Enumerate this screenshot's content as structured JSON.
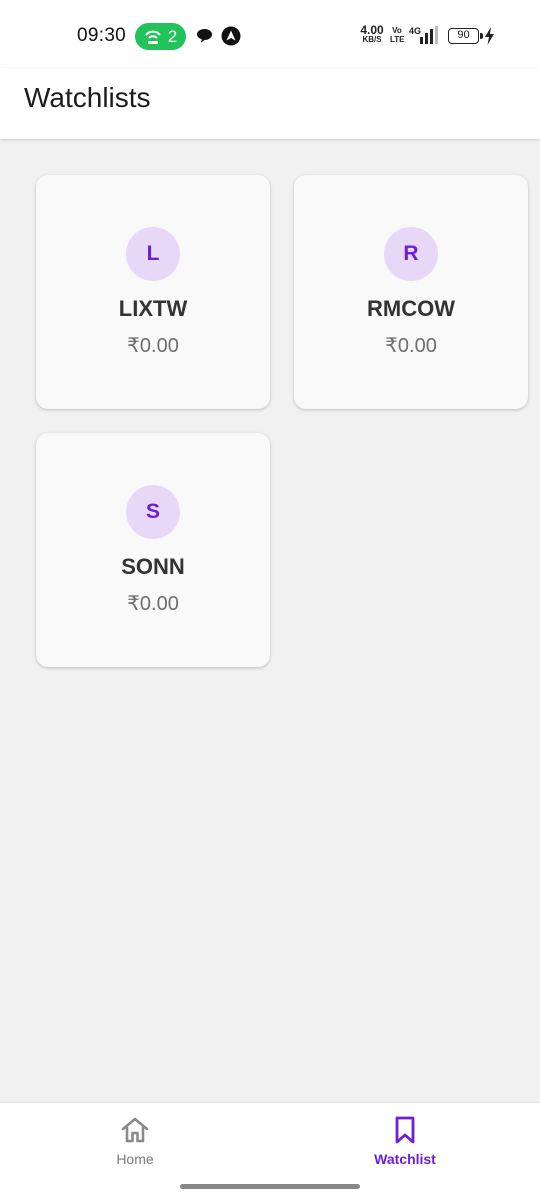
{
  "status_bar": {
    "time": "09:30",
    "hotspot_count": "2",
    "speed_value": "4.00",
    "speed_unit": "KB/S",
    "volte": "Vo LTE",
    "network": "4G",
    "battery": "90"
  },
  "header": {
    "title": "Watchlists"
  },
  "watchlists": [
    {
      "initial": "L",
      "name": "LIXTW",
      "value": "₹0.00"
    },
    {
      "initial": "R",
      "name": "RMCOW",
      "value": "₹0.00"
    },
    {
      "initial": "S",
      "name": "SONN",
      "value": "₹0.00"
    }
  ],
  "bottom_nav": {
    "items": [
      {
        "label": "Home",
        "icon": "home-icon",
        "active": false
      },
      {
        "label": "Watchlist",
        "icon": "bookmark-icon",
        "active": true
      }
    ]
  },
  "colors": {
    "accent": "#6c1fd6",
    "avatar_bg": "#e8d8f8",
    "background": "#f1f1f1",
    "hotspot_pill": "#22c35a"
  }
}
